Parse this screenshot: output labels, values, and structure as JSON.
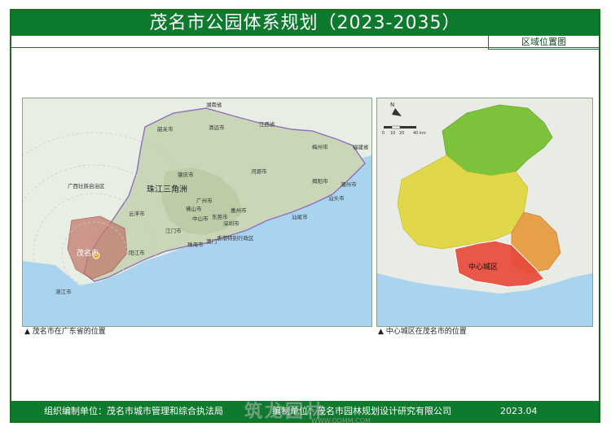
{
  "header": {
    "title": "茂名市公园体系规划（2023-2035）",
    "subtitle": "区域位置图"
  },
  "map_left": {
    "caption": "▲ 茂名市在广东省的位置",
    "labels": {
      "hunan": "湖南省",
      "jiangxi": "江西省",
      "fujian": "福建省",
      "guangxi": "广西壮族自治区",
      "delta": "珠江三角洲",
      "maoming": "茂名市",
      "zhanjiang": "湛江市",
      "yangjiang": "阳江市",
      "yunfu": "云浮市",
      "zhaoqing": "肇庆市",
      "qingyuan": "清远市",
      "shaoguan": "韶关市",
      "heyuan": "河源市",
      "meizhou": "梅州市",
      "chaozhou": "潮州市",
      "jieyang": "揭阳市",
      "shantou": "汕头市",
      "shanwei": "汕尾市",
      "huizhou": "惠州市",
      "guangzhou": "广州市",
      "foshan": "佛山市",
      "dongguan": "东莞市",
      "shenzhen": "深圳市",
      "zhongshan": "中山市",
      "jiangmen": "江门市",
      "zhuhai": "珠海市",
      "macau": "澳门",
      "hongkong": "香港特别行政区"
    }
  },
  "map_right": {
    "caption": "▲ 中心城区在茂名市的位置",
    "labels": {
      "center": "中心城区"
    },
    "scale": {
      "ticks": [
        "0",
        "10",
        "20",
        "40"
      ],
      "unit": "km"
    }
  },
  "footer": {
    "org": "组织编制单位：茂名市城市管理和综合执法局",
    "designer": "编制单位：茂名市园林规划设计研究有限公司",
    "date": "2023.04"
  },
  "watermark": {
    "text": "筑龙园林",
    "url": "WWW.ODMM.COM"
  },
  "colors": {
    "frame": "#0d7a2e",
    "sea": "#a9d4ef",
    "maoming_fill": "#c27a6e",
    "north_zone": "#7cc23a",
    "middle_zone": "#e0d84a",
    "south_zone": "#e6a04a",
    "center_zone": "#e84b3a"
  }
}
